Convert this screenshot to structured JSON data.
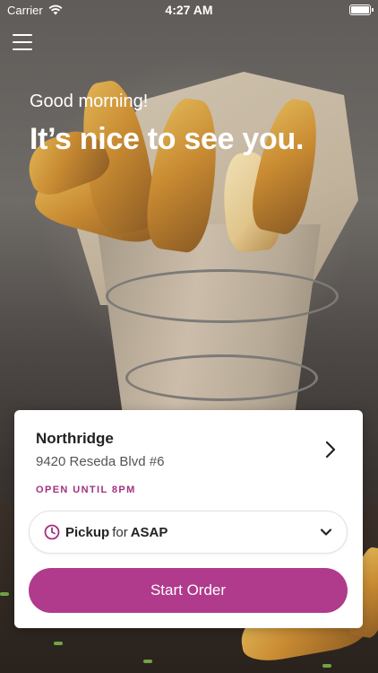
{
  "status_bar": {
    "carrier": "Carrier",
    "time": "4:27 AM"
  },
  "hero": {
    "greeting": "Good morning!",
    "headline": "It’s nice to see you."
  },
  "location_card": {
    "name": "Northridge",
    "address": "9420 Reseda Blvd #6",
    "open_status": "OPEN UNTIL 8PM",
    "pickup": {
      "mode": "Pickup",
      "connector": "for",
      "time": "ASAP"
    },
    "start_button": "Start Order"
  },
  "colors": {
    "accent": "#b03a8b",
    "open_status": "#a3307f"
  },
  "icons": {
    "menu": "hamburger-menu-icon",
    "wifi": "wifi-icon",
    "battery": "battery-icon",
    "location_chevron": "chevron-right-icon",
    "clock": "clock-icon",
    "dropdown": "chevron-down-icon"
  }
}
